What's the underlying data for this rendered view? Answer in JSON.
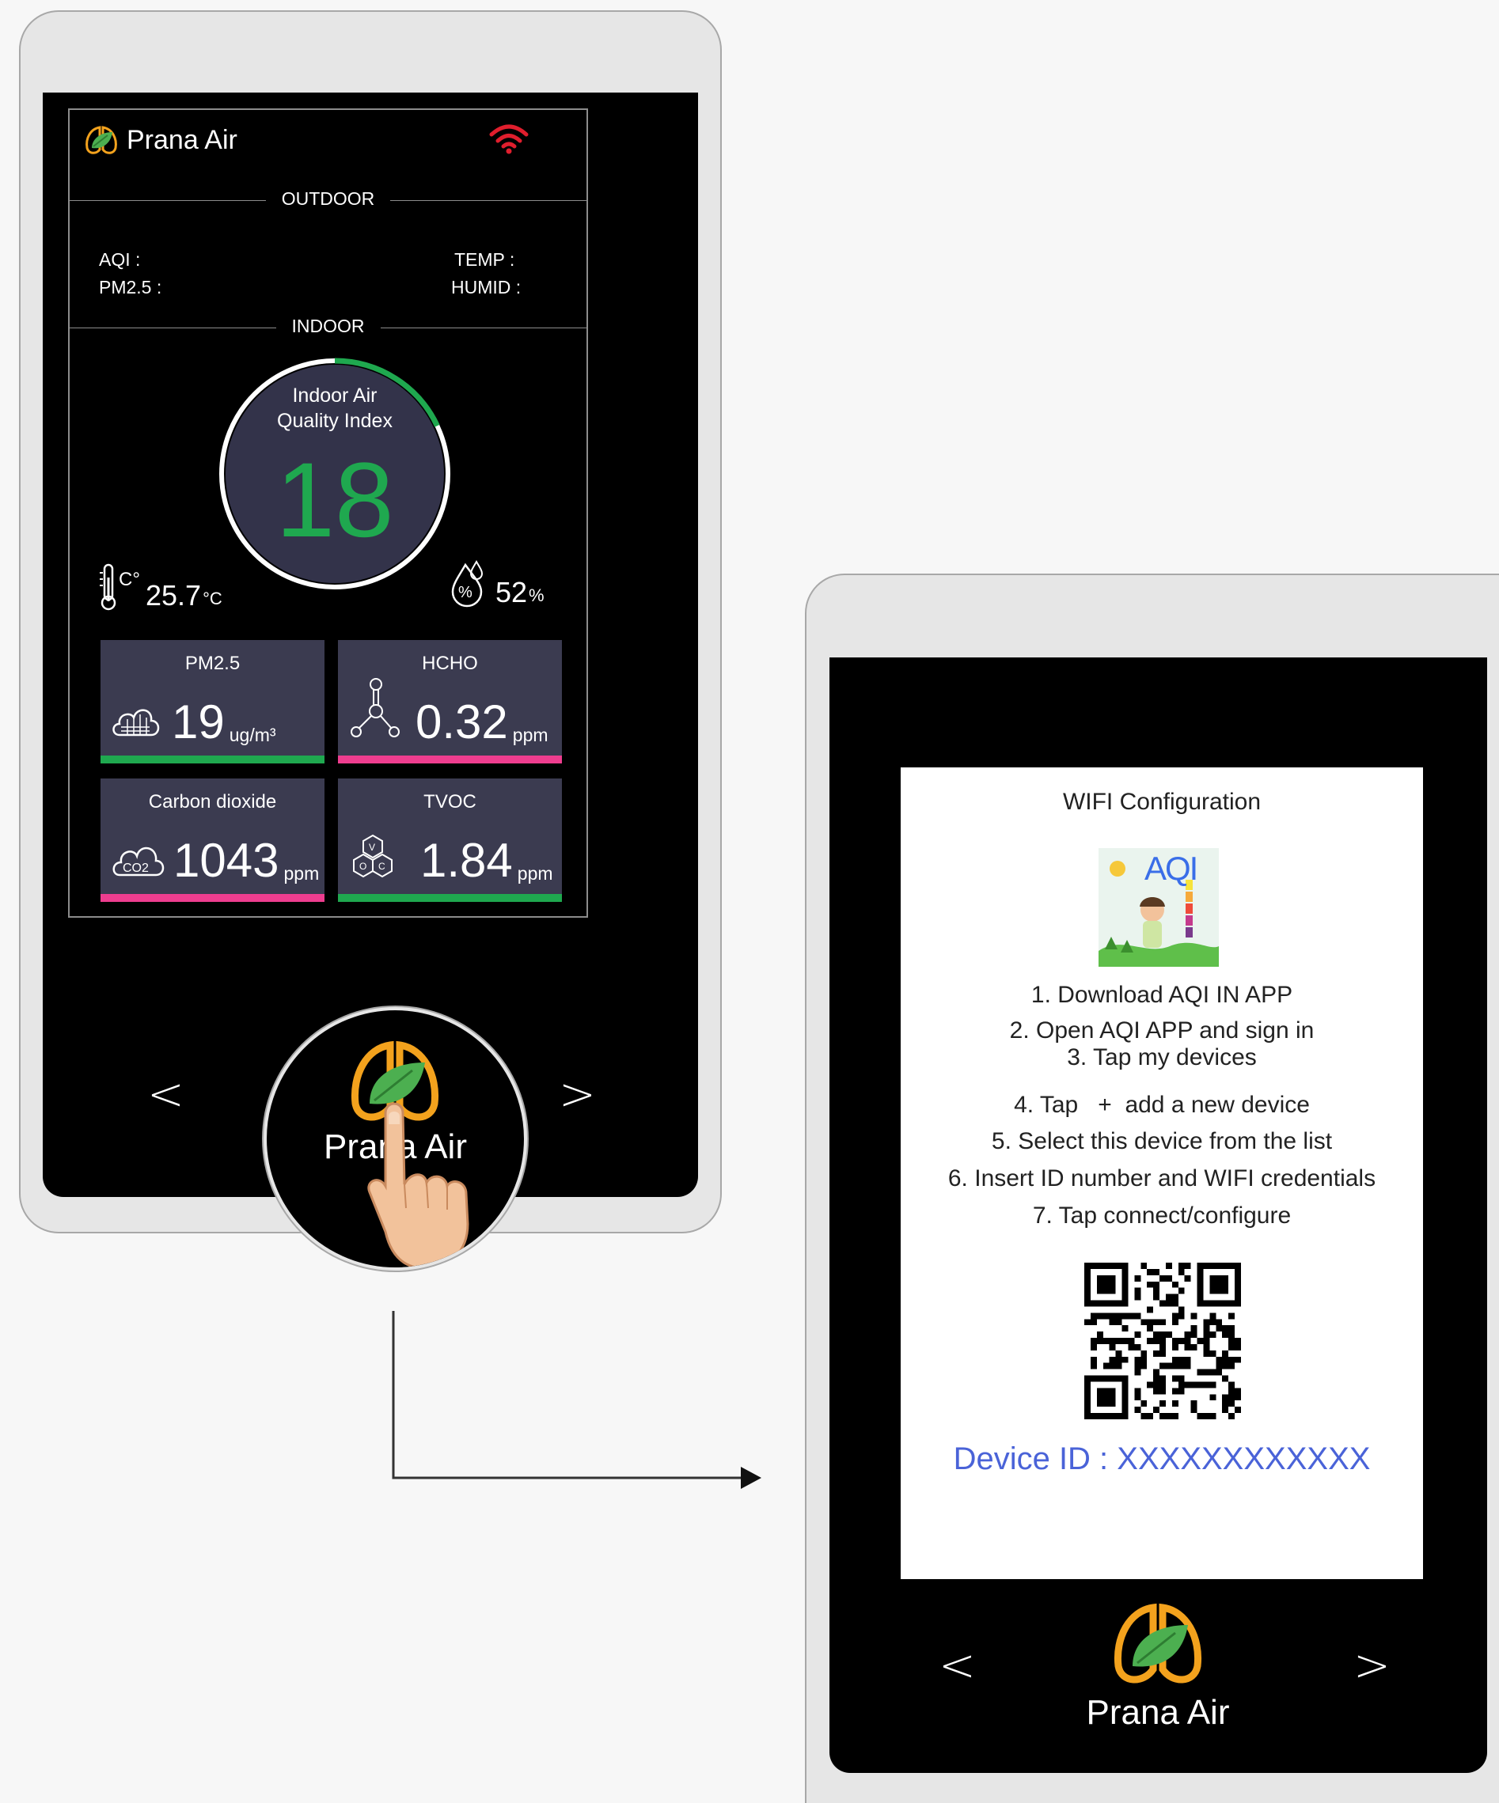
{
  "dashboard": {
    "brand": "Prana Air",
    "outdoor_label": "OUTDOOR",
    "indoor_label": "INDOOR",
    "aqi_label": "AQI :",
    "pm25_label": "PM2.5 :",
    "temp_label": "TEMP :",
    "humid_label": "HUMID :",
    "gauge_title_line1": "Indoor Air",
    "gauge_title_line2": "Quality Index",
    "gauge_value": "18",
    "temperature_value": "25.7",
    "temperature_unit": "°C",
    "humidity_value": "52",
    "humidity_unit": "%",
    "tiles": [
      {
        "name": "PM2.5",
        "value": "19",
        "unit": "ug/m³",
        "bar_color": "#1fa84f"
      },
      {
        "name": "HCHO",
        "value": "0.32",
        "unit": "ppm",
        "bar_color": "#ee3d8f"
      },
      {
        "name": "Carbon dioxide",
        "value": "1043",
        "unit": "ppm",
        "bar_color": "#ee3d8f"
      },
      {
        "name": "TVOC",
        "value": "1.84",
        "unit": "ppm",
        "bar_color": "#1fa84f"
      }
    ],
    "prev_arrow": "<",
    "next_arrow": ">",
    "zoom_brand": "Prana Air",
    "gauge_level": 0.18
  },
  "wifi_config": {
    "title": "WIFI Configuration",
    "app_logo_text": "AQI",
    "steps": [
      "1. Download AQI IN APP",
      "2. Open AQI APP and sign in",
      "3. Tap my devices",
      "4. Tap   +  add a new device",
      "5. Select this device from the list",
      "6. Insert ID number and WIFI credentials",
      "7. Tap connect/configure"
    ],
    "device_id": "Device ID : XXXXXXXXXXXX",
    "brand": "Prana Air",
    "prev_arrow": "<",
    "next_arrow": ">"
  },
  "colors": {
    "accent_green": "#1fa84f",
    "accent_pink": "#ee3d8f",
    "logo_orange": "#f3a21d",
    "wifi_red": "#e01e2d",
    "device_id_blue": "#4a63d8",
    "tile_bg": "#3b3b50"
  }
}
